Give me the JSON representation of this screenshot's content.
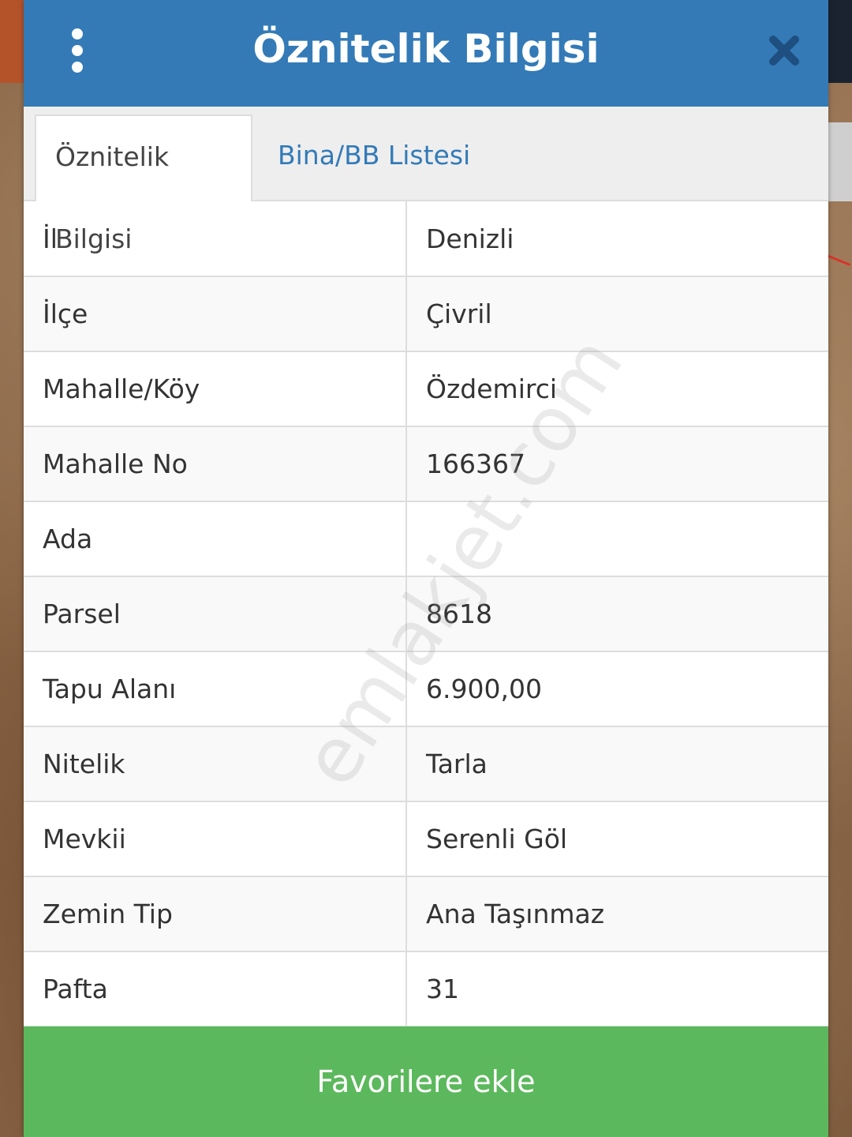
{
  "dialog": {
    "title": "Öznitelik Bilgisi"
  },
  "tabs": [
    {
      "label": "Öznitelik Bilgisi",
      "active": true
    },
    {
      "label": "Bina/BB Listesi",
      "active": false
    }
  ],
  "rows": [
    {
      "key": "İl",
      "value": "Denizli"
    },
    {
      "key": "İlçe",
      "value": "Çivril"
    },
    {
      "key": "Mahalle/Köy",
      "value": "Özdemirci"
    },
    {
      "key": "Mahalle No",
      "value": "166367"
    },
    {
      "key": "Ada",
      "value": ""
    },
    {
      "key": "Parsel",
      "value": "8618"
    },
    {
      "key": "Tapu Alanı",
      "value": "6.900,00"
    },
    {
      "key": "Nitelik",
      "value": "Tarla"
    },
    {
      "key": "Mevkii",
      "value": "Serenli Göl"
    },
    {
      "key": "Zemin Tip",
      "value": "Ana Taşınmaz"
    },
    {
      "key": "Pafta",
      "value": "31"
    }
  ],
  "footer": {
    "favorite_label": "Favorilere ekle"
  },
  "watermark": "emlakjet.com",
  "icons": {
    "menu": "vertical-dots-icon",
    "close": "close-icon"
  },
  "colors": {
    "header": "#337ab7",
    "tab_link": "#337ab7",
    "favorite_button": "#5cb85c"
  }
}
